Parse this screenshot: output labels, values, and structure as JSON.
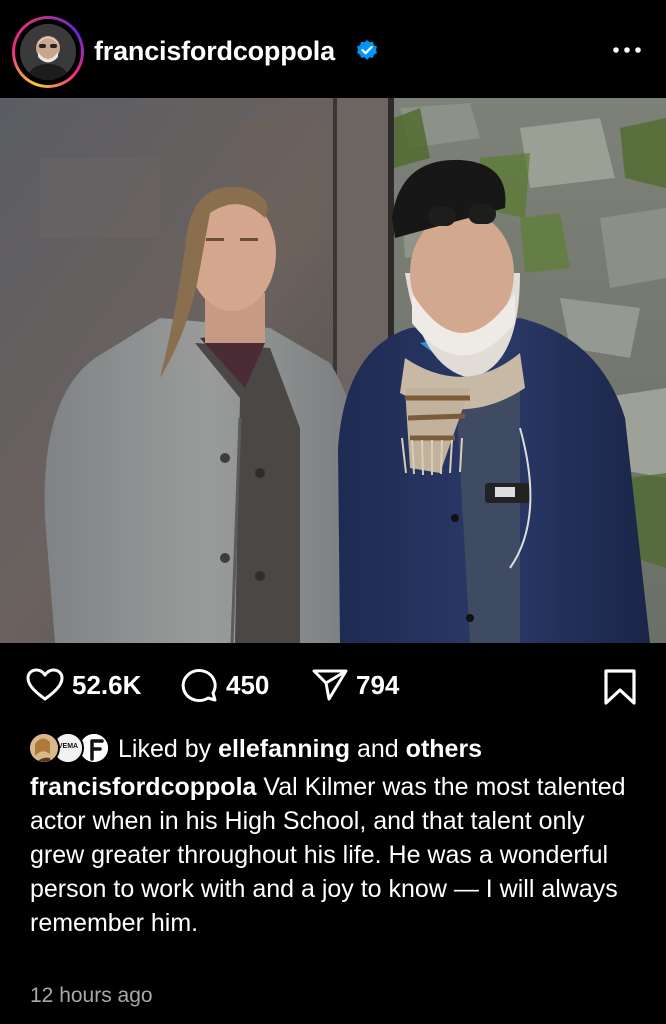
{
  "post": {
    "username": "francisfordcoppola",
    "verified": true,
    "more_icon": "more-horizontal-icon"
  },
  "actions": {
    "likes": "52.6K",
    "comments": "450",
    "shares": "794"
  },
  "liked_by": {
    "prefix": "Liked by",
    "user": "ellefanning",
    "and": "and",
    "others": "others",
    "avatar_badge_text": "VEMA"
  },
  "caption": {
    "username": "francisfordcoppola",
    "text": "Val Kilmer was the most talented actor when in his High School, and that talent only grew greater throughout his life. He was a wonderful person to work with and a joy to know — I will always remember him."
  },
  "timestamp": "12 hours ago",
  "colors": {
    "background": "#000000",
    "text": "#ffffff",
    "muted": "#a8a8a8",
    "verified_blue": "#0095f6"
  }
}
